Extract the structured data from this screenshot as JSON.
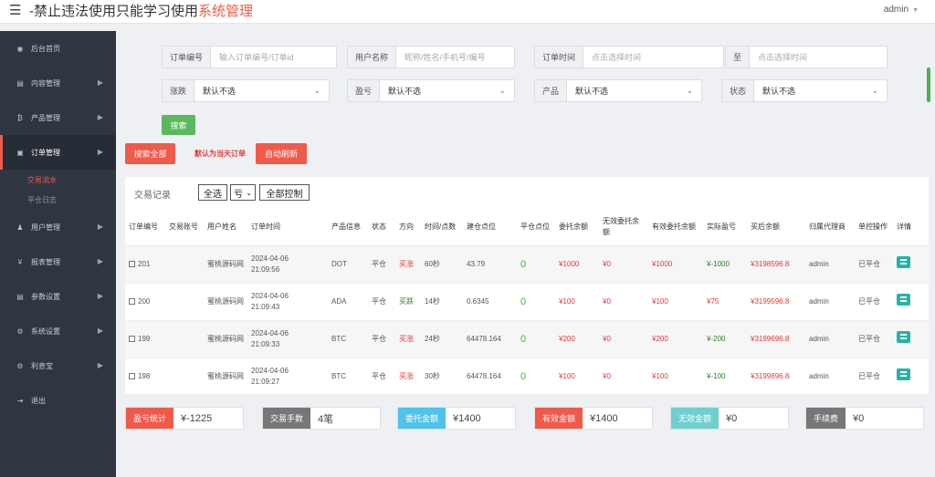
{
  "header": {
    "title_prefix": "-禁止违法使用只能学习使用",
    "title_highlight": "系统管理",
    "user": "admin"
  },
  "sidebar": {
    "items": [
      {
        "icon": "dashboard-icon",
        "glyph": "◉",
        "label": "后台首页",
        "arrow": false
      },
      {
        "icon": "content-icon",
        "glyph": "▤",
        "label": "内容管理",
        "arrow": true
      },
      {
        "icon": "bitcoin-icon",
        "glyph": "₿",
        "label": "产品管理",
        "arrow": true
      },
      {
        "icon": "order-icon",
        "glyph": "▣",
        "label": "订单管理",
        "arrow": true
      },
      {
        "icon": "user-icon",
        "glyph": "♟",
        "label": "用户管理",
        "arrow": true
      },
      {
        "icon": "yen-icon",
        "glyph": "¥",
        "label": "报表管理",
        "arrow": true
      },
      {
        "icon": "params-icon",
        "glyph": "▤",
        "label": "参数设置",
        "arrow": true
      },
      {
        "icon": "gear-icon",
        "glyph": "⚙",
        "label": "系统设置",
        "arrow": true
      },
      {
        "icon": "gear-icon",
        "glyph": "⚙",
        "label": "利息宝",
        "arrow": true
      },
      {
        "icon": "logout-icon",
        "glyph": "⇥",
        "label": "退出",
        "arrow": false
      }
    ],
    "subitems": [
      "交易流水",
      "平仓日志"
    ]
  },
  "filters": {
    "order_no_label": "订单编号",
    "order_no_placeholder": "输入订单编号/订单id",
    "username_label": "用户名称",
    "username_placeholder": "昵称/姓名/手机号/编号",
    "time_label": "订单时间",
    "time_placeholder": "点击选择时间",
    "to_label": "至",
    "to_placeholder": "点击选择时间",
    "updown_label": "涨跌",
    "updown_value": "默认不选",
    "profit_label": "盈亏",
    "profit_value": "默认不选",
    "product_label": "产品",
    "product_value": "默认不选",
    "status_label": "状态",
    "status_value": "默认不选",
    "search": "搜索",
    "search_all": "搜索全部",
    "today_note": "默认为当天订单",
    "auto_refresh": "自动刷新"
  },
  "panel": {
    "title": "交易记录",
    "select_all": "全选",
    "profit_select": "亏",
    "control_all": "全部控制"
  },
  "table": {
    "headers": [
      "订单编号",
      "交易账号",
      "用户姓名",
      "订单时间",
      "产品信息",
      "状态",
      "方向",
      "时间/点数",
      "建仓点位",
      "平仓点位",
      "委托余额",
      "无效委托余额",
      "有效委托余额",
      "实际盈亏",
      "买后余额",
      "归属代理商",
      "单控操作",
      "详情"
    ],
    "rows": [
      {
        "id": "201",
        "account": "",
        "name": "蜜桃源码网",
        "date": "2024-04-06",
        "time": "21:09:56",
        "product": "DOT",
        "status": "平仓",
        "dir": "买涨",
        "dir_color": "red",
        "duration": "60秒",
        "open": "43.79",
        "close": "0",
        "amount": "¥1000",
        "invalid": "¥0",
        "valid": "¥1000",
        "pnl": "¥-1000",
        "pnl_color": "green",
        "balance": "¥3198596.8",
        "agent": "admin",
        "control": "已平仓"
      },
      {
        "id": "200",
        "account": "",
        "name": "蜜桃源码网",
        "date": "2024-04-06",
        "time": "21:09:43",
        "product": "ADA",
        "status": "平仓",
        "dir": "买跌",
        "dir_color": "green",
        "duration": "14秒",
        "open": "0.6345",
        "close": "0",
        "amount": "¥100",
        "invalid": "¥0",
        "valid": "¥100",
        "pnl": "¥75",
        "pnl_color": "red",
        "balance": "¥3199596.8",
        "agent": "admin",
        "control": "已平仓"
      },
      {
        "id": "199",
        "account": "",
        "name": "蜜桃源码网",
        "date": "2024-04-06",
        "time": "21:09:33",
        "product": "BTC",
        "status": "平仓",
        "dir": "买涨",
        "dir_color": "red",
        "duration": "24秒",
        "open": "64478.164",
        "close": "0",
        "amount": "¥200",
        "invalid": "¥0",
        "valid": "¥200",
        "pnl": "¥-200",
        "pnl_color": "green",
        "balance": "¥3199696.8",
        "agent": "admin",
        "control": "已平仓"
      },
      {
        "id": "198",
        "account": "",
        "name": "蜜桃源码网",
        "date": "2024-04-06",
        "time": "21:09:27",
        "product": "BTC",
        "status": "平仓",
        "dir": "买涨",
        "dir_color": "red",
        "duration": "30秒",
        "open": "64478.164",
        "close": "0",
        "amount": "¥100",
        "invalid": "¥0",
        "valid": "¥100",
        "pnl": "¥-100",
        "pnl_color": "green",
        "balance": "¥3199896.8",
        "agent": "admin",
        "control": "已平仓"
      }
    ]
  },
  "stats": [
    {
      "label": "盈亏统计",
      "value": "¥-1225",
      "color": "#f05a4a"
    },
    {
      "label": "交易手数",
      "value": "4笔",
      "color": "#777777"
    },
    {
      "label": "委托金额",
      "value": "¥1400",
      "color": "#4fc3e8"
    },
    {
      "label": "有效金额",
      "value": "¥1400",
      "color": "#f05a4a"
    },
    {
      "label": "无效金额",
      "value": "¥0",
      "color": "#6fcfcf"
    },
    {
      "label": "手续费",
      "value": "¥0",
      "color": "#777777"
    }
  ]
}
